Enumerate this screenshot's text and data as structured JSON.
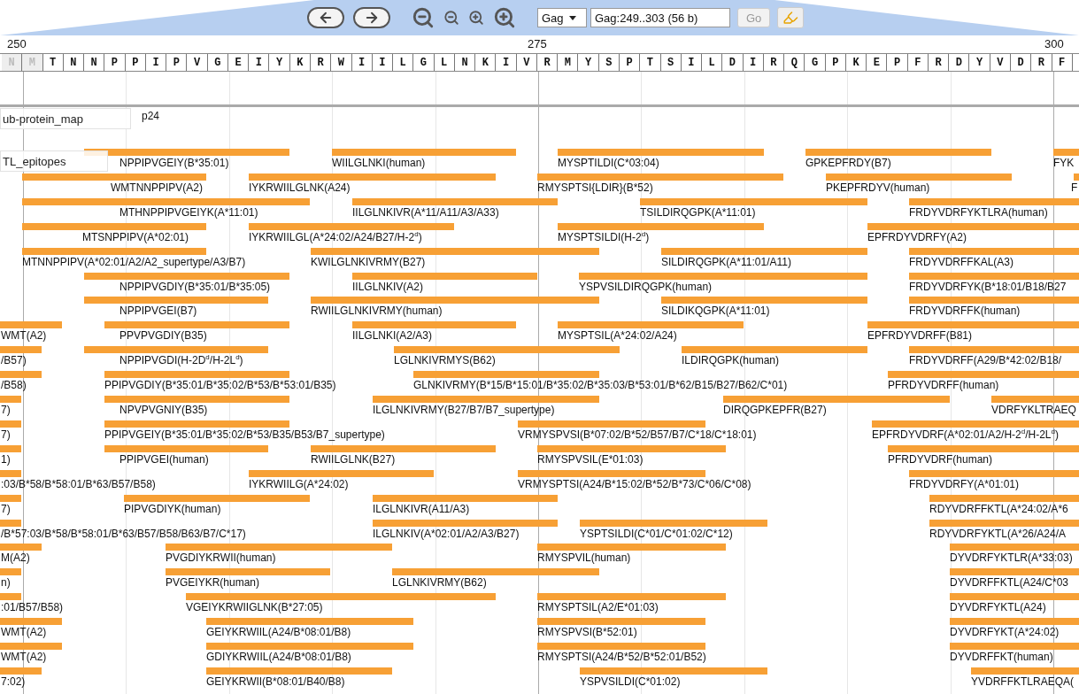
{
  "toolbar": {
    "reference": "Gag",
    "location": "Gag:249..303 (56 b)",
    "go_button": {
      "label": "Go",
      "disabled": true
    }
  },
  "ruler": {
    "ticks": [
      "250",
      "275",
      "300"
    ]
  },
  "sequence": [
    {
      "aa": "N",
      "dimmed": true
    },
    {
      "aa": "M",
      "dimmed": true
    },
    {
      "aa": "T",
      "dimmed": false
    },
    {
      "aa": "N",
      "dimmed": false
    },
    {
      "aa": "N",
      "dimmed": false
    },
    {
      "aa": "P",
      "dimmed": false
    },
    {
      "aa": "P",
      "dimmed": false
    },
    {
      "aa": "I",
      "dimmed": false
    },
    {
      "aa": "P",
      "dimmed": false
    },
    {
      "aa": "V",
      "dimmed": false
    },
    {
      "aa": "G",
      "dimmed": false
    },
    {
      "aa": "E",
      "dimmed": false
    },
    {
      "aa": "I",
      "dimmed": false
    },
    {
      "aa": "Y",
      "dimmed": false
    },
    {
      "aa": "K",
      "dimmed": false
    },
    {
      "aa": "R",
      "dimmed": false
    },
    {
      "aa": "W",
      "dimmed": false
    },
    {
      "aa": "I",
      "dimmed": false
    },
    {
      "aa": "I",
      "dimmed": false
    },
    {
      "aa": "L",
      "dimmed": false
    },
    {
      "aa": "G",
      "dimmed": false
    },
    {
      "aa": "L",
      "dimmed": false
    },
    {
      "aa": "N",
      "dimmed": false
    },
    {
      "aa": "K",
      "dimmed": false
    },
    {
      "aa": "I",
      "dimmed": false
    },
    {
      "aa": "V",
      "dimmed": false
    },
    {
      "aa": "R",
      "dimmed": false
    },
    {
      "aa": "M",
      "dimmed": false
    },
    {
      "aa": "Y",
      "dimmed": false
    },
    {
      "aa": "S",
      "dimmed": false
    },
    {
      "aa": "P",
      "dimmed": false
    },
    {
      "aa": "T",
      "dimmed": false
    },
    {
      "aa": "S",
      "dimmed": false
    },
    {
      "aa": "I",
      "dimmed": false
    },
    {
      "aa": "L",
      "dimmed": false
    },
    {
      "aa": "D",
      "dimmed": false
    },
    {
      "aa": "I",
      "dimmed": false
    },
    {
      "aa": "R",
      "dimmed": false
    },
    {
      "aa": "Q",
      "dimmed": false
    },
    {
      "aa": "G",
      "dimmed": false
    },
    {
      "aa": "P",
      "dimmed": false
    },
    {
      "aa": "K",
      "dimmed": false
    },
    {
      "aa": "E",
      "dimmed": false
    },
    {
      "aa": "P",
      "dimmed": false
    },
    {
      "aa": "F",
      "dimmed": false
    },
    {
      "aa": "R",
      "dimmed": false
    },
    {
      "aa": "D",
      "dimmed": false
    },
    {
      "aa": "Y",
      "dimmed": false
    },
    {
      "aa": "V",
      "dimmed": false
    },
    {
      "aa": "D",
      "dimmed": false
    },
    {
      "aa": "R",
      "dimmed": false
    },
    {
      "aa": "F",
      "dimmed": false
    }
  ],
  "protein_map_track": {
    "label": "ub-protein_map",
    "feature": "p24"
  },
  "epitope_track": {
    "label": "TL_epitopes",
    "rows": [
      [
        "NPPIPVGEIY(B*35:01)",
        "WIILGLNKI(human)",
        "MYSPTILDI(C*03:04)",
        "GPKEPFRDY(B7)",
        "FYK"
      ],
      [
        "WMTNNPPIPV(A2)",
        "IYKRWIILGLNK(A24)",
        "RMYSPTSI{LDIR}(B*52)",
        "PKEPFRDYV(human)",
        "F"
      ],
      [
        "MTHNPPIPVGEIYK(A*11:01)",
        "IILGLNKIVR(A*11/A11/A3/A33)",
        "TSILDIRQGPK(A*11:01)",
        "FRDYVDRFYKTLRA(human)"
      ],
      [
        "MTSNPPIPV(A*02:01)",
        "IYKRWIILGL(A*24:02/A24/B27/H-2$^{d}$)",
        "MYSPTSILDI(H-2$^{d}$)",
        "EPFRDYVDRFY(A2)"
      ],
      [
        "MTNNPPIPV(A*02:01/A2/A2_supertype/A3/B7)",
        "KWILGLNKIVRMY(B27)",
        "SILDIRQGPK(A*11:01/A11)",
        "FRDYVDRFFKAL(A3)"
      ],
      [
        "NPPIPVGDIY(B*35:01/B*35:05)",
        "IILGLNKIV(A2)",
        "YSPVSILDIRQGPK(human)",
        "FRDYVDRFYK(B*18:01/B18/B27"
      ],
      [
        "NPPIPVGEI(B7)",
        "RWIILGLNKIVRMY(human)",
        "SILDIKQGPK(A*11:01)",
        "FRDYVDRFFK(human)"
      ],
      [
        "WMT(A2)",
        "PPVPVGDIY(B35)",
        "IILGLNKI(A2/A3)",
        "MYSPTSIL(A*24:02/A24)",
        "EPFRDYVDRFF(B81)"
      ],
      [
        "/B57)",
        "NPPIPVGDI(H-2D$^{d}$/H-2L$^{d}$)",
        "LGLNKIVRMYS(B62)",
        "ILDIRQGPK(human)",
        "FRDYVDRFF(A29/B*42:02/B18/"
      ],
      [
        "/B58)",
        "PPIPVGDIY(B*35:01/B*35:02/B*53/B*53:01/B35)",
        "GLNKIVRMY(B*15/B*15:01/B*35:02/B*35:03/B*53:01/B*62/B15/B27/B62/C*01)",
        "PFRDYVDRFF(human)"
      ],
      [
        "7)",
        "NPVPVGNIY(B35)",
        "ILGLNKIVRMY(B27/B7/B7_supertype)",
        "DIRQGPKEPFR(B27)",
        "VDRFYKLTRAEQ"
      ],
      [
        "7)",
        "PPIPVGEIY(B*35:01/B*35:02/B*53/B35/B53/B7_supertype)",
        "VRMYSPVSI(B*07:02/B*52/B57/B7/C*18/C*18:01)",
        "EPFRDYVDRF(A*02:01/A2/H-2$^{d}$/H-2L$^{d}$)"
      ],
      [
        "1)",
        "PPIPVGEI(human)",
        "RWIILGLNK(B27)",
        "RMYSPVSIL(E*01:03)",
        "PFRDYVDRF(human)"
      ],
      [
        ":03/B*58/B*58:01/B*63/B57/B58)",
        "IYKRWIILG(A*24:02)",
        "VRMYSPTSI(A24/B*15:02/B*52/B*73/C*06/C*08)",
        "FRDYVDRFY(A*01:01)"
      ],
      [
        "7)",
        "PIPVGDIYK(human)",
        "ILGLNKIVR(A11/A3)",
        "RDYVDRFFKTL(A*24:02/A*6"
      ],
      [
        "/B*57:03/B*58/B*58:01/B*63/B57/B58/B63/B7/C*17)",
        "ILGLNKIV(A*02:01/A2/A3/B27)",
        "YSPTSILDI(C*01/C*01:02/C*12)",
        "RDYVDRFYKTL(A*26/A24/A"
      ],
      [
        "M(A2)",
        "PVGDIYKRWII(human)",
        "RMYSPVIL(human)",
        "DYVDRFYKTLR(A*33:03)"
      ],
      [
        "n)",
        "PVGEIYKR(human)",
        "LGLNKIVRMY(B62)",
        "DYVDRFFKTL(A24/C*03"
      ],
      [
        ":01/B57/B58)",
        "VGEIYKRWIIGLNK(B*27:05)",
        "RMYSPTSIL(A2/E*01:03)",
        "DYVDRFYKTL(A24)"
      ],
      [
        "WMT(A2)",
        "GEIYKRWIIL(A24/B*08:01/B8)",
        "RMYSPVSI(B*52:01)",
        "DYVDRFYKT(A*24:02)"
      ],
      [
        "WMT(A2)",
        "GDIYKRWIIL(A24/B*08:01/B8)",
        "RMYSPTSI(A24/B*52/B*52:01/B52)",
        "DYVDRFFKT(human)"
      ],
      [
        "7:02)",
        "GEIYKRWII(B*08:01/B40/B8)",
        "YSPVSILDI(C*01:02)",
        "YVDRFFKTLRAEQA("
      ]
    ]
  }
}
